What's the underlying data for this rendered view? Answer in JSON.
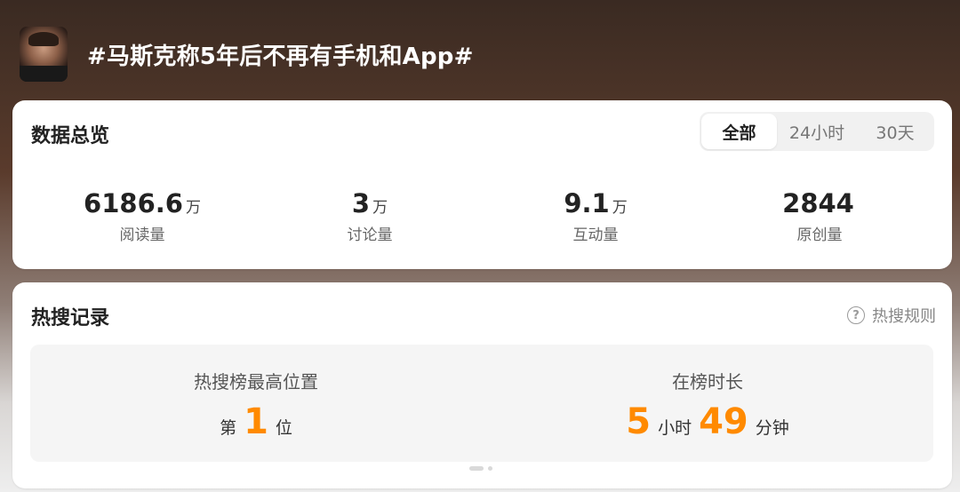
{
  "header": {
    "topic_title": "#马斯克称5年后不再有手机和App#"
  },
  "overview": {
    "title": "数据总览",
    "tabs": [
      {
        "label": "全部",
        "active": true
      },
      {
        "label": "24小时",
        "active": false
      },
      {
        "label": "30天",
        "active": false
      }
    ],
    "stats": [
      {
        "value": "6186.6",
        "unit": "万",
        "label": "阅读量"
      },
      {
        "value": "3",
        "unit": "万",
        "label": "讨论量"
      },
      {
        "value": "9.1",
        "unit": "万",
        "label": "互动量"
      },
      {
        "value": "2844",
        "unit": "",
        "label": "原创量"
      }
    ]
  },
  "hot_search": {
    "title": "热搜记录",
    "rules_label": "热搜规则",
    "peak": {
      "heading": "热搜榜最高位置",
      "prefix": "第",
      "value": "1",
      "suffix": "位"
    },
    "duration": {
      "heading": "在榜时长",
      "hours_value": "5",
      "hours_unit": "小时",
      "minutes_value": "49",
      "minutes_unit": "分钟"
    }
  },
  "colors": {
    "accent": "#ff8a00",
    "header_bg": "#4a3327"
  },
  "icons": {
    "avatar": "profile-photo",
    "rules": "question-circle-icon"
  }
}
